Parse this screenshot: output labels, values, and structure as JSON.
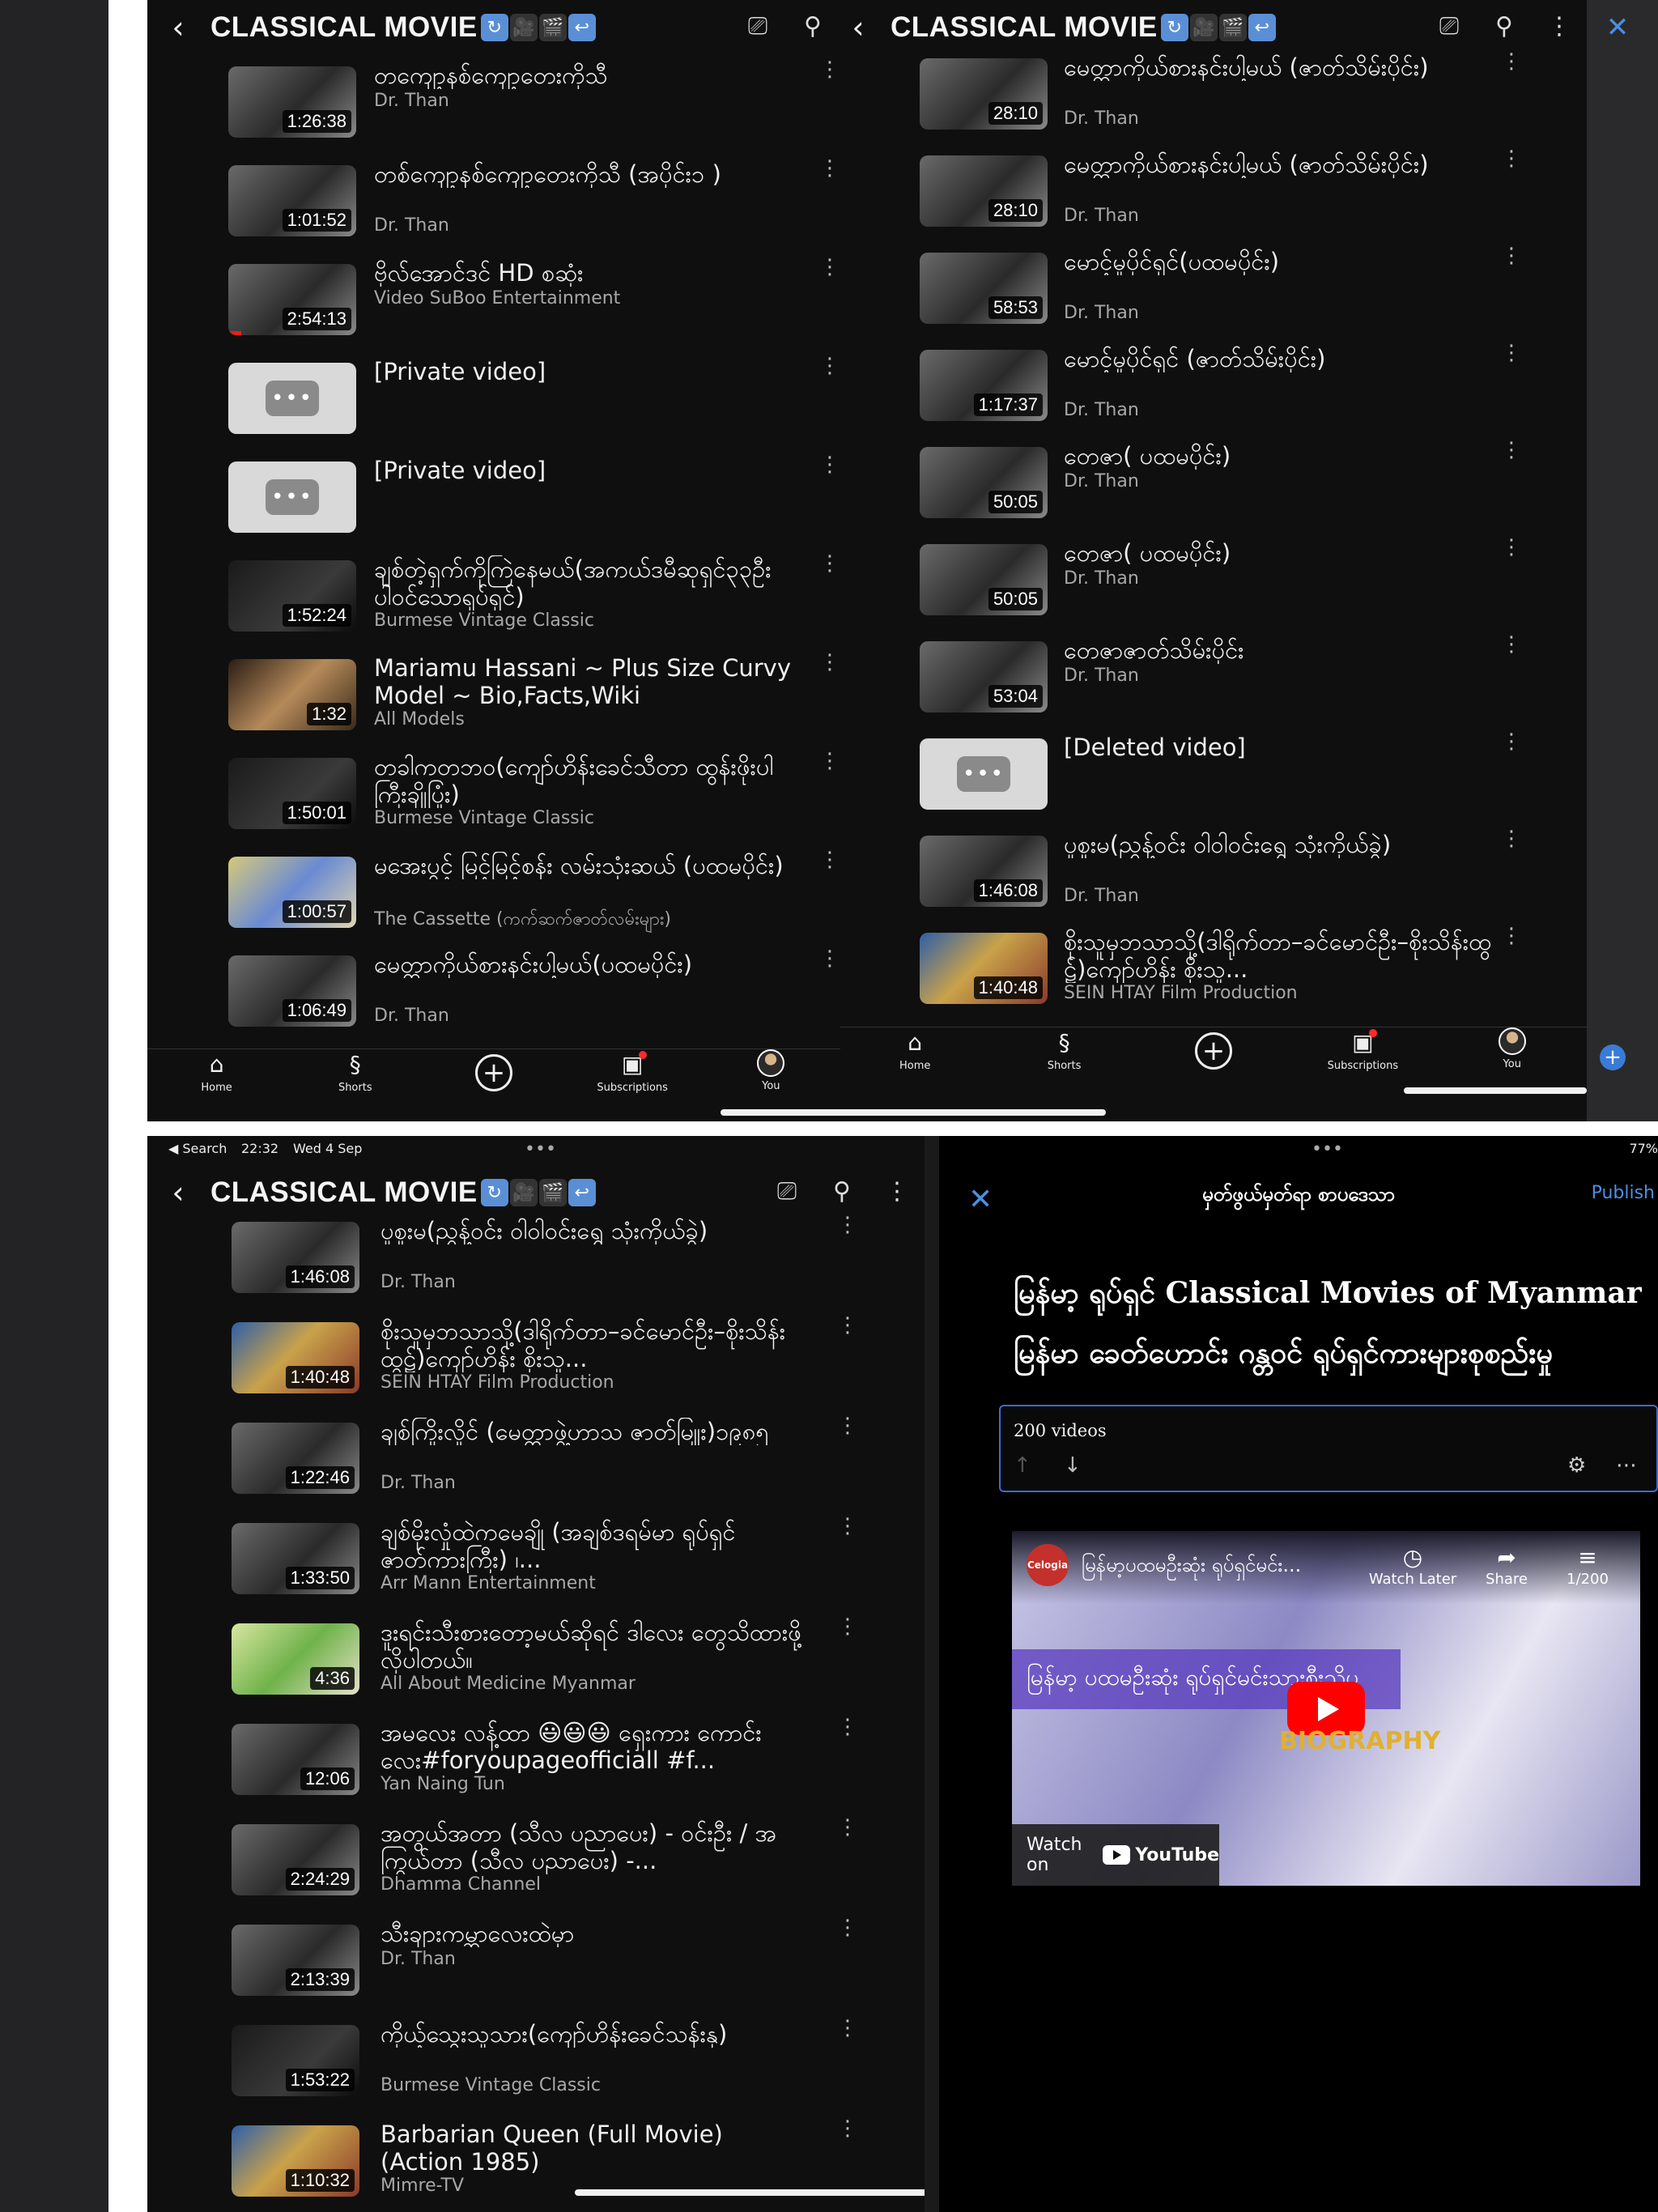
{
  "channel_title": "CLASSICAL MOVIE",
  "nav": {
    "home": "Home",
    "shorts": "Shorts",
    "subscriptions": "Subscriptions",
    "you": "You"
  },
  "panel1": {
    "videos": [
      {
        "title": "တကျော့နစ်ကျော့တေးကိုသီ",
        "channel": "Dr. Than",
        "duration": "1:26:38",
        "thumb": "photo"
      },
      {
        "title": "တစ်ကျော့နစ်ကျော့တေးကိုသီ (အပိုင်း၁ )",
        "channel": "Dr. Than",
        "duration": "1:01:52",
        "thumb": "photo"
      },
      {
        "title": "ဗိုလ်အောင်ဒင် HD စဆုံး",
        "channel": "Video SuBoo Entertainment",
        "duration": "2:54:13",
        "thumb": "photo"
      },
      {
        "title": "[Private video]",
        "channel": "",
        "duration": "",
        "thumb": "private"
      },
      {
        "title": "[Private video]",
        "channel": "",
        "duration": "",
        "thumb": "private"
      },
      {
        "title": "ချစ်တဲ့ရှက်ကိုကြဲနေမယ်(အကယ်ဒမီဆုရှင်၃၃ဦးပါဝင်သောရုပ်ရှင်)",
        "channel": "Burmese Vintage Classic",
        "duration": "1:52:24",
        "thumb": "dark"
      },
      {
        "title": "Mariamu Hassani ~ Plus Size Curvy Model ~ Bio,Facts,Wiki",
        "channel": "All Models",
        "duration": "1:32",
        "thumb": "body"
      },
      {
        "title": "တခါကတဘဝ(ကျော်ဟိန်းခေင်သီတာ ထွန်းဖိုးပါကြီးချိုပြုံး)",
        "channel": "Burmese Vintage Classic",
        "duration": "1:50:01",
        "thumb": "dark"
      },
      {
        "title": "မအေးပွင့် မြင့်မြင့်စန်း လမ်းသုံးဆယ် (ပထမပိုင်း)",
        "channel": "The Cassette (ကက်ဆက်ဇာတ်လမ်းများ)",
        "duration": "1:00:57",
        "thumb": "gold"
      },
      {
        "title": "မေတ္တာကိုယ်စားနင်းပါ့မယ်(ပထမပိုင်း)",
        "channel": "Dr. Than",
        "duration": "1:06:49",
        "thumb": "photo"
      }
    ]
  },
  "panel2": {
    "videos": [
      {
        "title": "မေတ္တာကိုယ်စားနင်းပါ့မယ် (ဇာတ်သိမ်းပိုင်း)",
        "channel": "Dr. Than",
        "duration": "28:10",
        "thumb": "photo"
      },
      {
        "title": "မေတ္တာကိုယ်စားနင်းပါ့မယ် (ဇာတ်သိမ်းပိုင်း)",
        "channel": "Dr. Than",
        "duration": "28:10",
        "thumb": "photo"
      },
      {
        "title": "မောင့်မှုပိုင်ရှင်(ပထမပိုင်း)",
        "channel": "Dr. Than",
        "duration": "58:53",
        "thumb": "photo"
      },
      {
        "title": "မောင့်မှုပိုင်ရှင် (ဇာတ်သိမ်းပိုင်း)",
        "channel": "Dr. Than",
        "duration": "1:17:37",
        "thumb": "photo"
      },
      {
        "title": "တေဇာ( ပထမပိုင်း)",
        "channel": "Dr. Than",
        "duration": "50:05",
        "thumb": "photo"
      },
      {
        "title": "တေဇာ( ပထမပိုင်း)",
        "channel": "Dr. Than",
        "duration": "50:05",
        "thumb": "photo"
      },
      {
        "title": "တေဇာဇာတ်သိမ်းပိုင်း",
        "channel": "Dr. Than",
        "duration": "53:04",
        "thumb": "photo"
      },
      {
        "title": "[Deleted video]",
        "channel": "",
        "duration": "",
        "thumb": "private"
      },
      {
        "title": "ပူစူးမ(ညွှန့်ဝင်း ဝါဝါဝင်းရွှေ သုံးကိုယ်ခွဲ)",
        "channel": "Dr. Than",
        "duration": "1:46:08",
        "thumb": "photo"
      },
      {
        "title": "စိုးသူမှဘသာသို့(ဒါရိုက်တာ–ခင်မောင်ဦး–စိုးသိန်းထွဋ်)ကျော်ဟိန်း စိုးသူ...",
        "channel": "SEIN HTAY Film Production",
        "duration": "1:40:48",
        "thumb": "color"
      }
    ]
  },
  "panel3": {
    "status": {
      "back": "◀ Search",
      "time": "22:32",
      "date": "Wed 4 Sep"
    },
    "videos": [
      {
        "title": "ပူစူးမ(ညွှန့်ဝင်း ဝါဝါဝင်းရွှေ သုံးကိုယ်ခွဲ)",
        "channel": "Dr. Than",
        "duration": "1:46:08",
        "thumb": "photo"
      },
      {
        "title": "စိုးသူမှဘသာသို့(ဒါရိုက်တာ–ခင်မောင်ဦး–စိုးသိန်းထွဋ်)ကျော်ဟိန်း စိုးသူ...",
        "channel": "SEIN HTAY Film Production",
        "duration": "1:40:48",
        "thumb": "color"
      },
      {
        "title": "ချစ်ကြိုးလှိုင် (မေတ္တာဖွဲ့ဟာသ ဇာတ်မြူး)၁၉၈၅",
        "channel": "Dr. Than",
        "duration": "1:22:46",
        "thumb": "photo"
      },
      {
        "title": "ချစ်မိုးလှုံထဲကမေချို (အချစ်ဒရမ်မာ ရုပ်ရှင်ဇာတ်ကားကြီး) ၊...",
        "channel": "Arr Mann Entertainment",
        "duration": "1:33:50",
        "thumb": "photo"
      },
      {
        "title": "ဒူးရင်းသီးစားတော့မယ်ဆိုရင် ဒါလေး တွေသိထားဖို့ လိုပါတယ်။",
        "channel": "All About Medicine Myanmar",
        "duration": "4:36",
        "thumb": "green"
      },
      {
        "title": "အမလေး လန့်ထာ 😃😃😃 ရှေးကား ကောင်းလေး#foryoupageofficiall #f...",
        "channel": "Yan Naing Tun",
        "duration": "12:06",
        "thumb": "photo"
      },
      {
        "title": "အတွယ်အတာ (သီလ ပညာပေး) - ဝင်းဦး / အကြွယ်တာ (သီလ ပညာပေး) -...",
        "channel": "Dhamma Channel",
        "duration": "2:24:29",
        "thumb": "photo"
      },
      {
        "title": "သီးချားကမ္ဘာလေးထဲမှာ",
        "channel": "Dr. Than",
        "duration": "2:13:39",
        "thumb": "photo"
      },
      {
        "title": "ကိုယ့်သွေးသူသား(ကျော်ဟိန်းခေင်သန်းနု)",
        "channel": "Burmese Vintage Classic",
        "duration": "1:53:22",
        "thumb": "dark"
      },
      {
        "title": "Barbarian Queen (Full Movie)(Action 1985)",
        "channel": "Mimre-TV",
        "duration": "1:10:32",
        "thumb": "color"
      }
    ]
  },
  "panel4": {
    "status_right": "77%",
    "header_title": "မှတ်ဖွယ်မှတ်ရာ စာပဒေသာ",
    "publish": "Publish",
    "title_line1": "မြန်မာ့ ရုပ်ရှင် Classical Movies of Myanmar",
    "title_line2": "မြန်မာ ခေတ်ဟောင်း ဂန္တဝင် ရုပ်ရှင်ကားများစုစည်းမှု",
    "playlist_count": "200 videos",
    "embed": {
      "logo": "Celogia",
      "title": "မြန်မာ့ပထမဦးဆုံး ရုပ်ရှင်မင်း...",
      "watch_later": "Watch Later",
      "share": "Share",
      "counter": "1/200",
      "banner": "မြန်မာ့ ပထမဦးဆုံး ရုပ်ရှင်မင်းသားစီးသိုပ",
      "bio": "BIOGRAPHY",
      "watch_on": "Watch on",
      "youtube": "YouTube"
    }
  }
}
